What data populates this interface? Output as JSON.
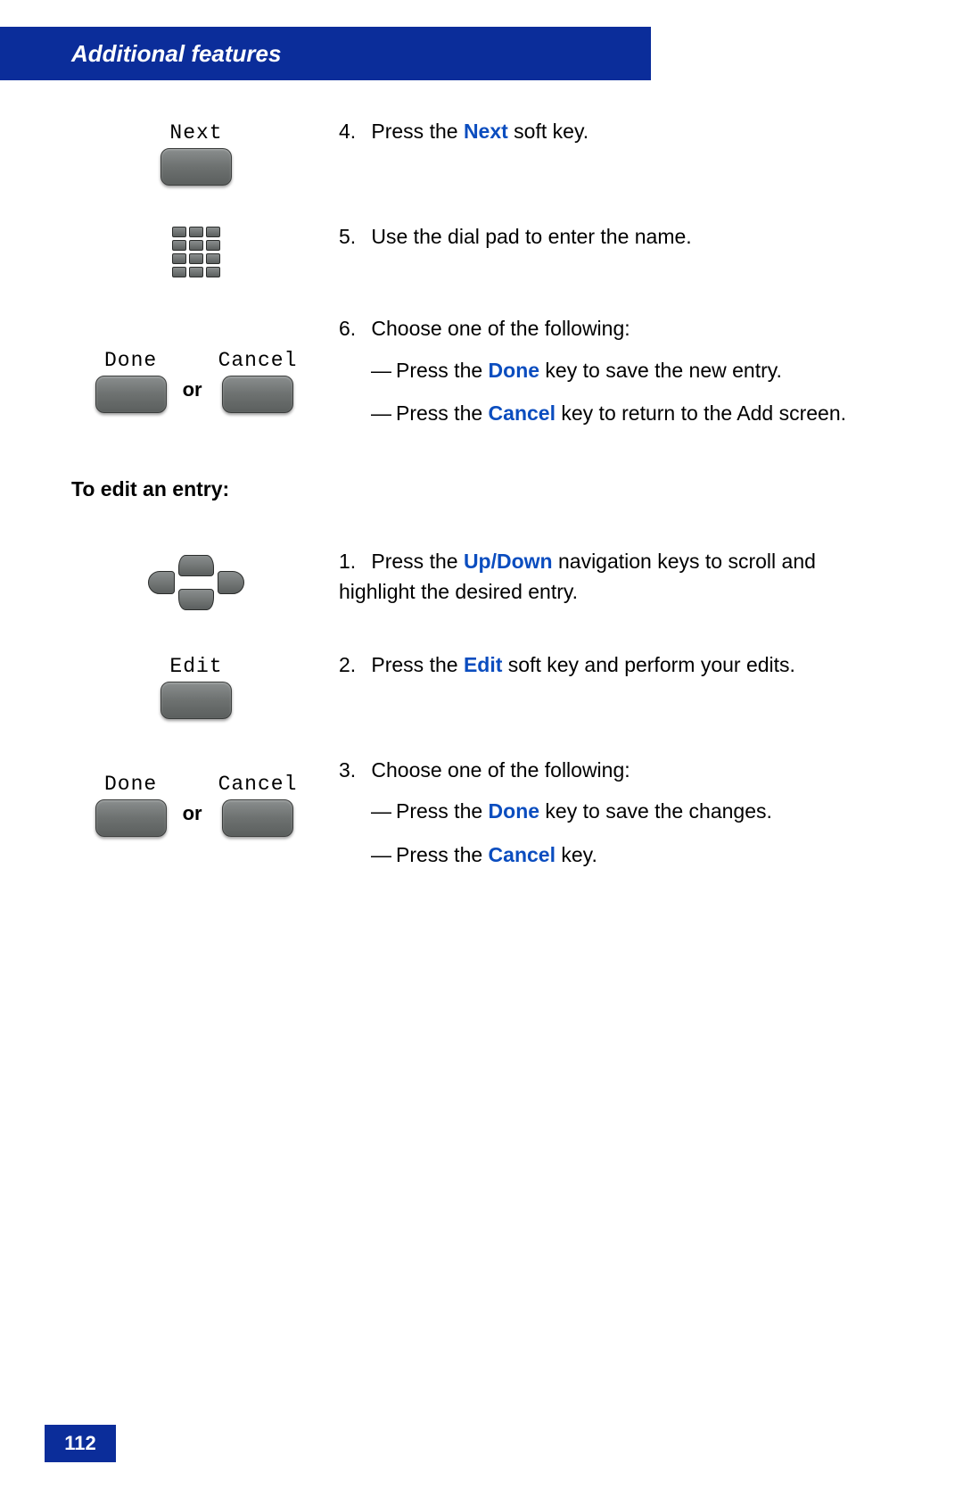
{
  "header": {
    "title": "Additional features"
  },
  "steps_a": [
    {
      "num": "4.",
      "text_before": "Press the ",
      "highlight": "Next",
      "text_after": " soft key.",
      "key_label": "Next"
    },
    {
      "num": "5.",
      "text_before": "Use the dial pad to enter the name.",
      "highlight": "",
      "text_after": ""
    },
    {
      "num": "6.",
      "text_before": "Choose one of the following:",
      "highlight": "",
      "text_after": "",
      "key_label_a": "Done",
      "key_label_b": "Cancel",
      "or": "or",
      "sub": [
        {
          "before": "Press the ",
          "hl": "Done",
          "after": " key to save the new entry."
        },
        {
          "before": "Press the ",
          "hl": "Cancel",
          "after": " key to return to the Add screen."
        }
      ]
    }
  ],
  "section_heading": "To edit an entry:",
  "steps_b": [
    {
      "num": "1.",
      "text_before": "Press the ",
      "highlight": "Up/Down",
      "text_after": " navigation keys to scroll and highlight the desired entry."
    },
    {
      "num": "2.",
      "text_before": "Press the ",
      "highlight": "Edit",
      "text_after": " soft key and perform your edits.",
      "key_label": "Edit"
    },
    {
      "num": "3.",
      "text_before": "Choose one of the following:",
      "highlight": "",
      "text_after": "",
      "key_label_a": "Done",
      "key_label_b": "Cancel",
      "or": "or",
      "sub": [
        {
          "before": "Press the ",
          "hl": "Done",
          "after": " key to save the changes."
        },
        {
          "before": "Press the ",
          "hl": "Cancel",
          "after": " key."
        }
      ]
    }
  ],
  "footer": {
    "page": "112"
  }
}
